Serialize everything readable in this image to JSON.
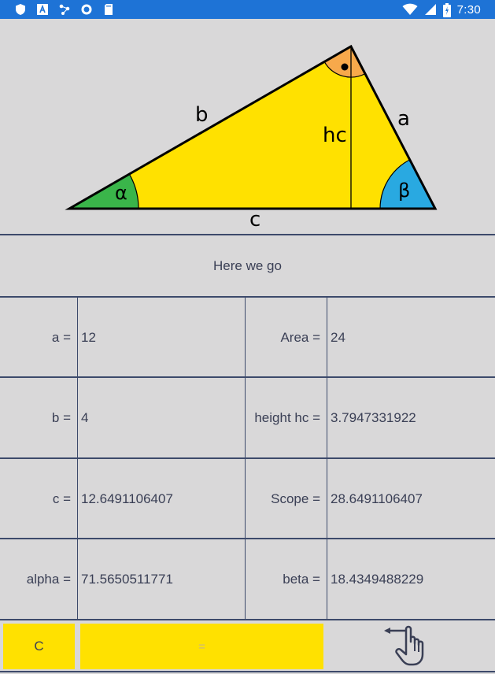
{
  "status_bar": {
    "time": "7:30",
    "left_icons": [
      "shield-icon",
      "font-a-icon",
      "share-dots-icon",
      "circle-icon",
      "sd-card-icon"
    ],
    "right_icons": [
      "wifi-icon",
      "signal-icon",
      "battery-charging-icon"
    ]
  },
  "diagram": {
    "labels": {
      "side_a": "a",
      "side_b": "b",
      "side_c": "c",
      "height": "hc",
      "angle_alpha": "α",
      "angle_beta": "β"
    },
    "colors": {
      "triangle_fill": "#ffe100",
      "alpha_fill": "#3ab54a",
      "beta_fill": "#29a9e1",
      "right_angle_fill": "#f7a94b"
    }
  },
  "message": "Here we go",
  "results": [
    {
      "left_label": "a =",
      "left_value": "12",
      "right_label": "Area =",
      "right_value": "24"
    },
    {
      "left_label": "b =",
      "left_value": "4",
      "right_label": "height hc =",
      "right_value": "3.7947331922"
    },
    {
      "left_label": "c =",
      "left_value": "12.6491106407",
      "right_label": "Scope =",
      "right_value": "28.6491106407"
    },
    {
      "left_label": "alpha =",
      "left_value": "71.5650511771",
      "right_label": "beta =",
      "right_value": "18.4349488229"
    }
  ],
  "buttons": {
    "clear_label": "C",
    "equals_label": "=",
    "back_icon": "swipe-back-hand-icon"
  },
  "colors": {
    "background": "#d9d8d9",
    "status_bar": "#1e73d6",
    "button_yellow": "#ffe100",
    "grid_lines": "#3d4a6b"
  }
}
